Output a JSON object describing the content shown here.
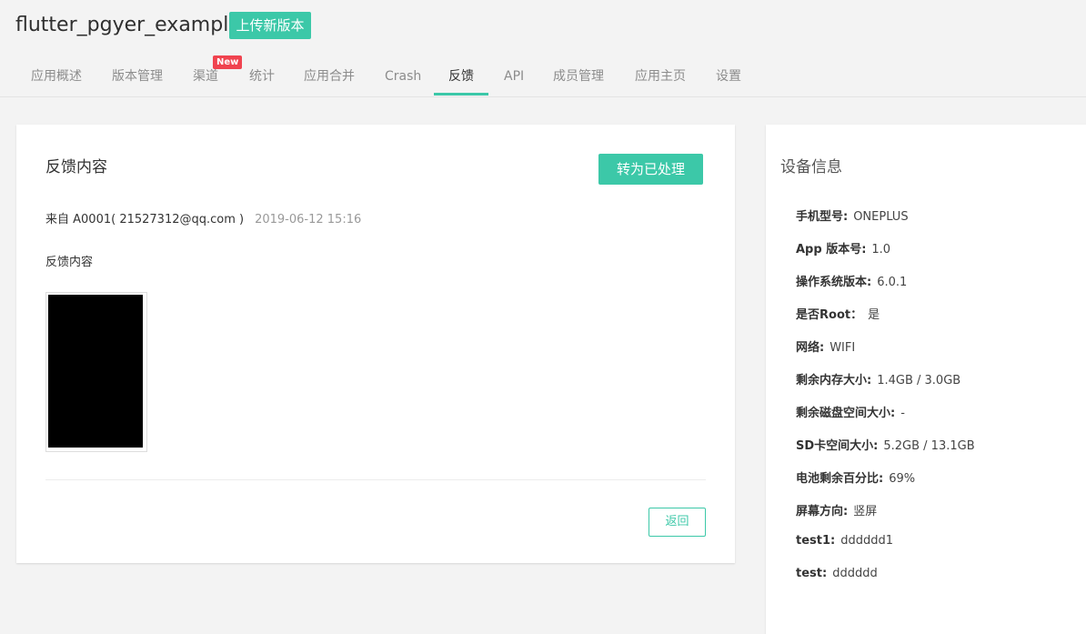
{
  "header": {
    "app_title": "flutter_pgyer_example",
    "upload_button": "上传新版本",
    "tabs": [
      {
        "label": "应用概述"
      },
      {
        "label": "版本管理"
      },
      {
        "label": "渠道",
        "badge": "New"
      },
      {
        "label": "统计"
      },
      {
        "label": "应用合并"
      },
      {
        "label": "Crash"
      },
      {
        "label": "反馈",
        "active": true
      },
      {
        "label": "API"
      },
      {
        "label": "成员管理"
      },
      {
        "label": "应用主页"
      },
      {
        "label": "设置"
      }
    ]
  },
  "feedback": {
    "title": "反馈内容",
    "mark_button": "转为已处理",
    "from": "来自 A0001( 21527312@qq.com )",
    "date": "2019-06-12 15:16",
    "content": "反馈内容",
    "back_button": "返回"
  },
  "device": {
    "title": "设备信息",
    "rows": [
      {
        "key": "手机型号:",
        "value": "ONEPLUS"
      },
      {
        "key": "App 版本号:",
        "value": "1.0"
      },
      {
        "key": "操作系统版本:",
        "value": "6.0.1"
      },
      {
        "key": "是否Root：",
        "value": "是"
      },
      {
        "key": "网络:",
        "value": "WIFI"
      },
      {
        "key": "剩余内存大小:",
        "value": "1.4GB / 3.0GB"
      },
      {
        "key": "剩余磁盘空间大小:",
        "value": "-"
      },
      {
        "key": "SD卡空间大小:",
        "value": "5.2GB / 13.1GB"
      },
      {
        "key": "电池剩余百分比:",
        "value": "69%"
      },
      {
        "key": "屏幕方向:",
        "value": "竖屏"
      },
      {
        "key": "test1:",
        "value": "dddddd1"
      },
      {
        "key": "test:",
        "value": "dddddd"
      }
    ]
  },
  "colors": {
    "accent": "#3cc8a8",
    "badge": "#f0434f",
    "background": "#f3f3f3"
  }
}
